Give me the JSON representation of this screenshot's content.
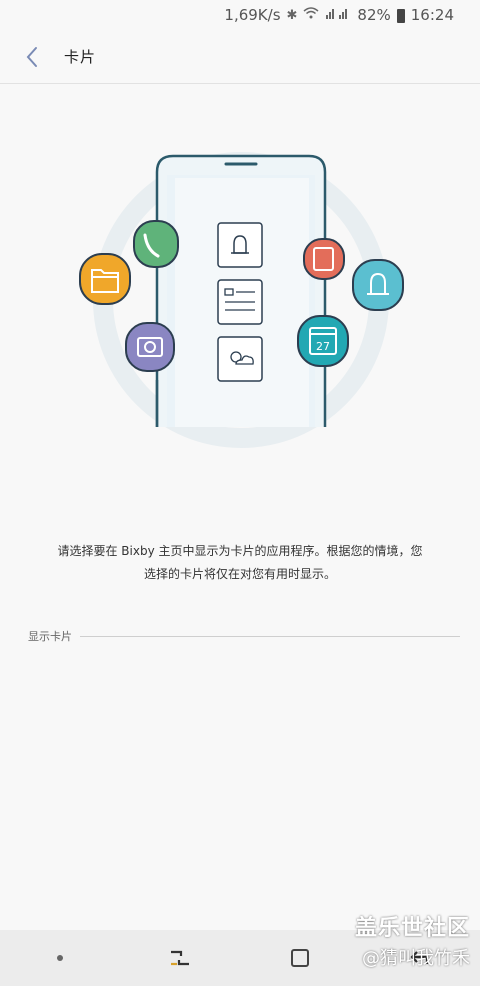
{
  "status_bar": {
    "speed": "1,69K/s",
    "battery": "82%",
    "time": "16:24",
    "icons": [
      "bluetooth-icon",
      "wifi-icon",
      "signal-icon",
      "battery-icon"
    ]
  },
  "header": {
    "title": "卡片",
    "back_icon": "chevron-left-icon"
  },
  "illustration": {
    "card_icons": [
      "bell-icon",
      "list-card-icon",
      "weather-icon"
    ],
    "app_icons": [
      {
        "name": "phone-icon",
        "color": "#5fb37a"
      },
      {
        "name": "folder-icon",
        "color": "#f0a72a"
      },
      {
        "name": "camera-icon",
        "color": "#8a86c2"
      },
      {
        "name": "card-icon",
        "color": "#e36d5a"
      },
      {
        "name": "reminder-icon",
        "color": "#5bbfd0"
      },
      {
        "name": "calendar-icon",
        "color": "#22a8b3",
        "day": "27"
      }
    ]
  },
  "description": {
    "line1": "请选择要在 Bixby 主页中显示为卡片的应用程序。根据您的情境，您",
    "line2": "选择的卡片将仅在对您有用时显示。"
  },
  "section": {
    "label": "显示卡片"
  },
  "nav_bar": {
    "buttons": [
      "menu-dot",
      "recents-button",
      "home-button",
      "back-button"
    ]
  },
  "watermark": {
    "line1": "盖乐世社区",
    "line2": "@猜叫我竹禾"
  }
}
